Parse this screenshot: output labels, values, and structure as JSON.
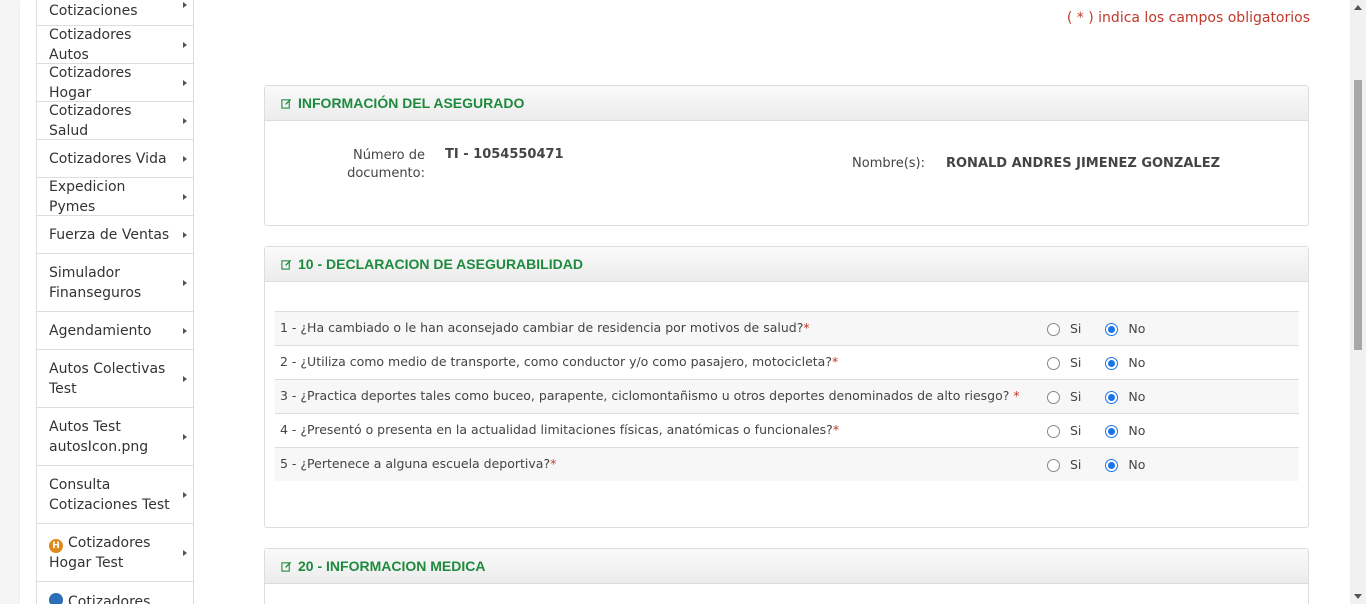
{
  "sidebar": {
    "items": [
      {
        "label": "Cotizaciones",
        "icon": null
      },
      {
        "label": "Cotizadores Autos",
        "icon": null
      },
      {
        "label": "Cotizadores Hogar",
        "icon": null
      },
      {
        "label": "Cotizadores Salud",
        "icon": null
      },
      {
        "label": "Cotizadores Vida",
        "icon": null
      },
      {
        "label": "Expedicion Pymes",
        "icon": null
      },
      {
        "label": "Fuerza de Ventas",
        "icon": null
      },
      {
        "label": "Simulador Finanseguros",
        "icon": null
      },
      {
        "label": "Agendamiento",
        "icon": null
      },
      {
        "label": "Autos Colectivas Test",
        "icon": null
      },
      {
        "label": "Autos Test autosIcon.png",
        "icon": null
      },
      {
        "label": "Consulta Cotizaciones Test",
        "icon": null
      },
      {
        "label": "Cotizadores Hogar Test",
        "icon": "house-badge-icon",
        "icon_letter": "H",
        "icon_color": "#e08a1e"
      },
      {
        "label": "Cotizadores",
        "icon": "blue-badge-icon",
        "icon_letter": "",
        "icon_color": "#2a6fb8"
      }
    ]
  },
  "main": {
    "required_note": "( * ) indica los campos obligatorios",
    "insured_panel": {
      "title": "INFORMACIÓN DEL ASEGURADO",
      "doc_label": "Número de documento:",
      "doc_value": "TI - 1054550471",
      "name_label": "Nombre(s):",
      "name_value": "RONALD ANDRES JIMENEZ GONZALEZ"
    },
    "declaration_panel": {
      "title": "10 - DECLARACION DE ASEGURABILIDAD",
      "option_yes": "Si",
      "option_no": "No",
      "questions": [
        {
          "text": "1 - ¿Ha cambiado o le han aconsejado cambiar de residencia por motivos de salud?",
          "required": "*",
          "answer": "No"
        },
        {
          "text": "2 - ¿Utiliza como medio de transporte, como conductor y/o como pasajero, motocicleta?",
          "required": "*",
          "answer": "No"
        },
        {
          "text": "3 - ¿Practica deportes tales como buceo, parapente, ciclomontañismo u otros deportes denominados de alto riesgo? ",
          "required": "*",
          "answer": "No"
        },
        {
          "text": "4 - ¿Presentó o presenta en la actualidad limitaciones físicas, anatómicas o funcionales?",
          "required": "*",
          "answer": "No"
        },
        {
          "text": "5 - ¿Pertenece a alguna escuela deportiva?",
          "required": "*",
          "answer": "No"
        }
      ]
    },
    "medical_panel": {
      "title": "20 - INFORMACION MEDICA"
    }
  },
  "colors": {
    "section_title": "#1e8a3e",
    "required": "#c0392b",
    "radio_checked": "#1a73e8"
  }
}
